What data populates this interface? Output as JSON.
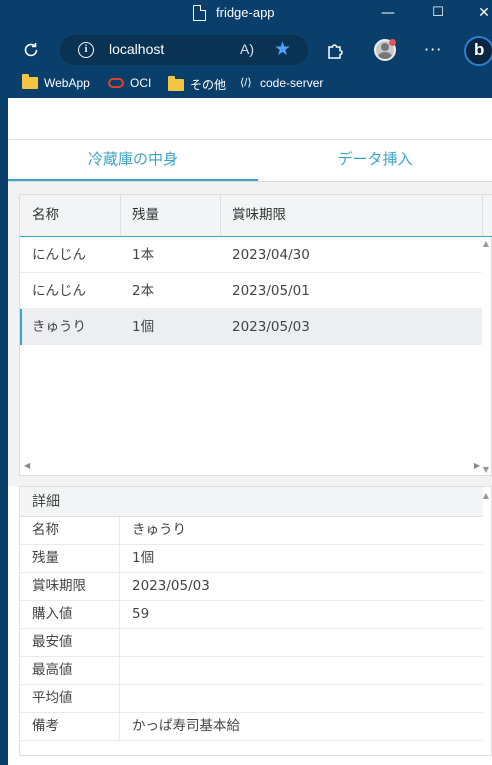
{
  "window": {
    "title": "fridge-app",
    "minimize": "—",
    "maximize": "☐",
    "close": "✕"
  },
  "browser": {
    "url": "localhost",
    "read_aloud": "A)",
    "more": "···",
    "bing": "b"
  },
  "bookmarks": [
    {
      "label": "WebApp",
      "icon": "folder-icon"
    },
    {
      "label": "OCI",
      "icon": "oci-icon"
    },
    {
      "label": "その他",
      "icon": "folder-icon"
    },
    {
      "label": "code-server",
      "icon": "vscode-icon"
    }
  ],
  "tabs": [
    {
      "label": "冷蔵庫の中身",
      "active": true
    },
    {
      "label": "データ挿入",
      "active": false
    }
  ],
  "grid": {
    "columns": [
      "名称",
      "残量",
      "賞味期限"
    ],
    "rows": [
      {
        "name": "にんじん",
        "amount": "1本",
        "expiry": "2023/04/30"
      },
      {
        "name": "にんじん",
        "amount": "2本",
        "expiry": "2023/05/01"
      },
      {
        "name": "きゅうり",
        "amount": "1個",
        "expiry": "2023/05/03"
      }
    ],
    "selected_row": 2
  },
  "detail": {
    "title": "詳細",
    "fields": [
      {
        "label": "名称",
        "value": "きゅうり"
      },
      {
        "label": "残量",
        "value": "1個"
      },
      {
        "label": "賞味期限",
        "value": "2023/05/03"
      },
      {
        "label": "購入値",
        "value": "59"
      },
      {
        "label": "最安値",
        "value": ""
      },
      {
        "label": "最高値",
        "value": ""
      },
      {
        "label": "平均値",
        "value": ""
      },
      {
        "label": "備考",
        "value": "かっぱ寿司基本給"
      }
    ]
  },
  "colors": {
    "chrome": "#0b3f6b",
    "accent": "#3aa4c8",
    "selected_row": "#eceef2"
  }
}
